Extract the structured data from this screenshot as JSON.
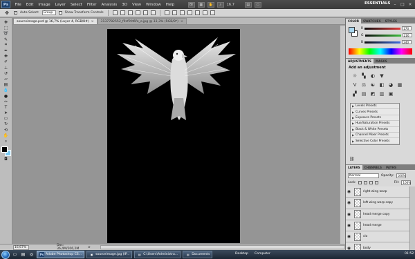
{
  "app": {
    "logo": "Ps",
    "menu": [
      "File",
      "Edit",
      "Image",
      "Layer",
      "Select",
      "Filter",
      "Analysis",
      "3D",
      "View",
      "Window",
      "Help"
    ],
    "zoom_menu": "16.7",
    "workspace": "ESSENTIALS",
    "win_min": "–",
    "win_max": "□",
    "win_close": "×"
  },
  "options": {
    "auto_select_label": "Auto-Select:",
    "auto_select_value": "Group",
    "show_transform_label": "Show Transform Controls"
  },
  "tabs": [
    {
      "label": "sourceimage.psd @ 16,7% (Layer 4, RGB/8#)",
      "close": "×"
    },
    {
      "label": "3137782552_f9cf0fd6fe_o.jpg @ 33,3% (RGB/8*)",
      "close": "×"
    }
  ],
  "status": {
    "zoom": "16,67%",
    "doc": "Doc: 36,4M/206,2M",
    "arrow": "▸"
  },
  "color_panel": {
    "tabs": [
      "COLOR",
      "SWATCHES",
      "STYLES"
    ],
    "sliders": [
      {
        "label": "R",
        "value": "170",
        "color": "#e03a3a"
      },
      {
        "label": "G",
        "value": "216",
        "color": "#3fbf3f"
      },
      {
        "label": "B",
        "value": "240",
        "color": "#3f6fe0"
      }
    ],
    "fg_color": "#aad8f0"
  },
  "adjustments_panel": {
    "tabs": [
      "ADJUSTMENTS",
      "MASKS"
    ],
    "title": "Add an adjustment",
    "icon_rows": [
      [
        "☼",
        "▚",
        "◐",
        "▼"
      ],
      [
        "V",
        "⚖",
        "☯",
        "◧",
        "◕",
        "▦"
      ],
      [
        "▞",
        "▤",
        "◩",
        "▥",
        "▣"
      ]
    ],
    "presets": [
      "Levels Presets",
      "Curves Presets",
      "Exposure Presets",
      "Hue/Saturation Presets",
      "Black & White Presets",
      "Channel Mixer Presets",
      "Selective Color Presets"
    ]
  },
  "layers_panel": {
    "tabs": [
      "LAYERS",
      "CHANNELS",
      "PATHS"
    ],
    "blend_mode": "Normal",
    "opacity_label": "Opacity:",
    "opacity": "100%",
    "lock_label": "Lock:",
    "fill_label": "Fill:",
    "fill": "100%",
    "layers": [
      "right wing warp",
      "left wing warp copy",
      "head merge copy",
      "head merge",
      "clo",
      "body"
    ]
  },
  "taskbar": {
    "tasks": [
      {
        "label": "Adobe Photoshop CS...",
        "icon": "Ps",
        "active": true
      },
      {
        "label": "sourceimage.jpg (IP...",
        "icon": "▣",
        "active": false
      },
      {
        "label": "C:\\Users\\Administra...",
        "icon": "▤",
        "active": false
      },
      {
        "label": "Documents",
        "icon": "▤",
        "active": false
      }
    ],
    "desktop": "Desktop",
    "computer": "Computer",
    "clock": "01:52"
  }
}
